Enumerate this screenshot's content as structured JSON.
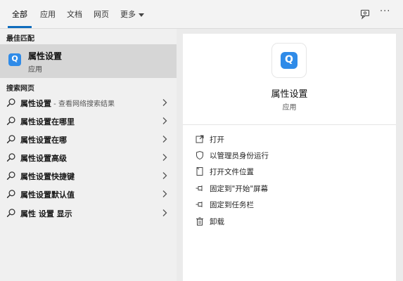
{
  "tabs": [
    {
      "label": "全部"
    },
    {
      "label": "应用"
    },
    {
      "label": "文档"
    },
    {
      "label": "网页"
    },
    {
      "label": "更多"
    }
  ],
  "top_icons": [
    "feedback-icon",
    "more-options-icon"
  ],
  "more_dots": "···",
  "best_match": {
    "section_label": "最佳匹配",
    "title": "属性设置",
    "subtitle": "应用",
    "icon": "app-q-icon"
  },
  "web_search": {
    "section_label": "搜索网页",
    "items": [
      {
        "label": "属性设置",
        "suffix": " - 查看网络搜索结果"
      },
      {
        "label": "属性设置在哪里",
        "suffix": ""
      },
      {
        "label": "属性设置在哪",
        "suffix": ""
      },
      {
        "label": "属性设置高级",
        "suffix": ""
      },
      {
        "label": "属性设置快捷键",
        "suffix": ""
      },
      {
        "label": "属性设置默认值",
        "suffix": ""
      },
      {
        "label": "属性 设置 显示",
        "suffix": ""
      }
    ]
  },
  "detail": {
    "title": "属性设置",
    "subtitle": "应用",
    "actions": [
      {
        "label": "打开",
        "icon": "open-icon"
      },
      {
        "label": "以管理员身份运行",
        "icon": "run-as-admin-icon"
      },
      {
        "label": "打开文件位置",
        "icon": "file-location-icon"
      },
      {
        "label": "固定到\"开始\"屏幕",
        "icon": "pin-icon"
      },
      {
        "label": "固定到任务栏",
        "icon": "pin-icon"
      },
      {
        "label": "卸载",
        "icon": "trash-icon"
      }
    ]
  },
  "colors": {
    "accent": "#0f6cbd",
    "app_icon": "#2f8be8"
  }
}
